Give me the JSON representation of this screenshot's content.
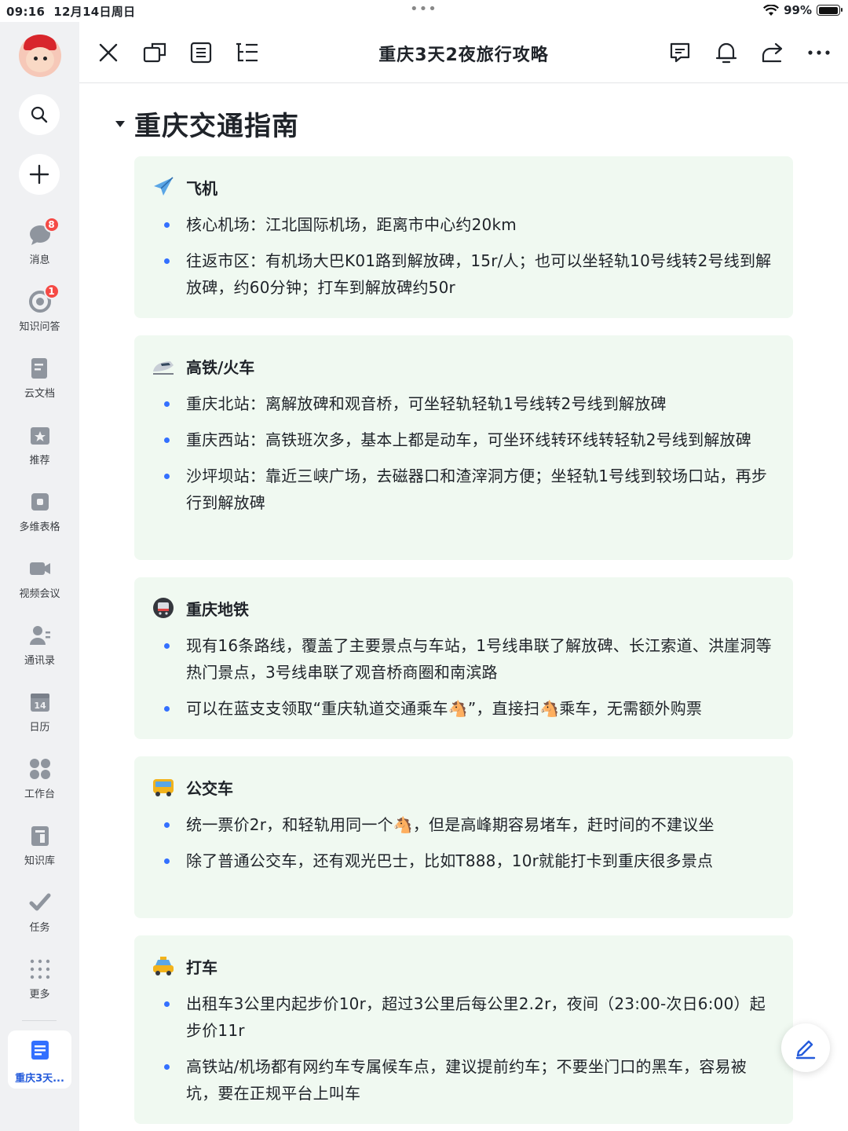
{
  "status": {
    "time": "09:16",
    "date": "12月14日周日",
    "battery": "99%",
    "battery_level": 0.99
  },
  "sidebar": {
    "items": [
      {
        "label": "消息",
        "badge": "8"
      },
      {
        "label": "知识问答",
        "badge": "1"
      },
      {
        "label": "云文档"
      },
      {
        "label": "推荐"
      },
      {
        "label": "多维表格"
      },
      {
        "label": "视频会议"
      },
      {
        "label": "通讯录"
      },
      {
        "label": "日历",
        "icon_text": "14"
      },
      {
        "label": "工作台"
      },
      {
        "label": "知识库"
      },
      {
        "label": "任务"
      },
      {
        "label": "更多"
      }
    ],
    "active_doc": "重庆3天..."
  },
  "topbar": {
    "title": "重庆3天2夜旅行攻略"
  },
  "doc": {
    "heading": "重庆交通指南",
    "sections": [
      {
        "icon": "airplane-icon",
        "title": "飞机",
        "bullets": [
          "核心机场：江北国际机场，距离市中心约20km",
          "往返市区：有机场大巴K01路到解放碑，15r/人；也可以坐轻轨10号线转2号线到解放碑，约60分钟；打车到解放碑约50r"
        ]
      },
      {
        "icon": "train-icon",
        "title": "高铁/火车",
        "bullets": [
          "重庆北站：离解放碑和观音桥，可坐轻轨轻轨1号线转2号线到解放碑",
          "重庆西站：高铁班次多，基本上都是动车，可坐环线转环线转轻轨2号线到解放碑",
          "沙坪坝站：靠近三峡广场，去磁器口和渣滓洞方便；坐轻轨1号线到较场口站，再步行到解放碑"
        ]
      },
      {
        "icon": "metro-icon",
        "title": "重庆地铁",
        "bullets": [
          "现有16条路线，覆盖了主要景点与车站，1号线串联了解放碑、长江索道、洪崖洞等热门景点，3号线串联了观音桥商圈和南滨路",
          "可以在蓝支支领取“重庆轨道交通乘车🐴”，直接扫🐴乘车，无需额外购票"
        ]
      },
      {
        "icon": "bus-icon",
        "title": "公交车",
        "bullets": [
          "统一票价2r，和轻轨用同一个🐴，但是高峰期容易堵车，赶时间的不建议坐",
          "除了普通公交车，还有观光巴士，比如T888，10r就能打卡到重庆很多景点"
        ]
      },
      {
        "icon": "taxi-icon",
        "title": "打车",
        "bullets": [
          "出租车3公里内起步价10r，超过3公里后每公里2.2r，夜间（23:00-次日6:00）起步价11r",
          "高铁站/机场都有网约车专属候车点，建议提前约车；不要坐门口的黑车，容易被坑，要在正规平台上叫车"
        ]
      }
    ]
  },
  "colors": {
    "accent": "#3370ff",
    "card_bg": "#f0f9f1",
    "badge": "#f54a45",
    "sidebar_bg": "#f0f1f3"
  }
}
